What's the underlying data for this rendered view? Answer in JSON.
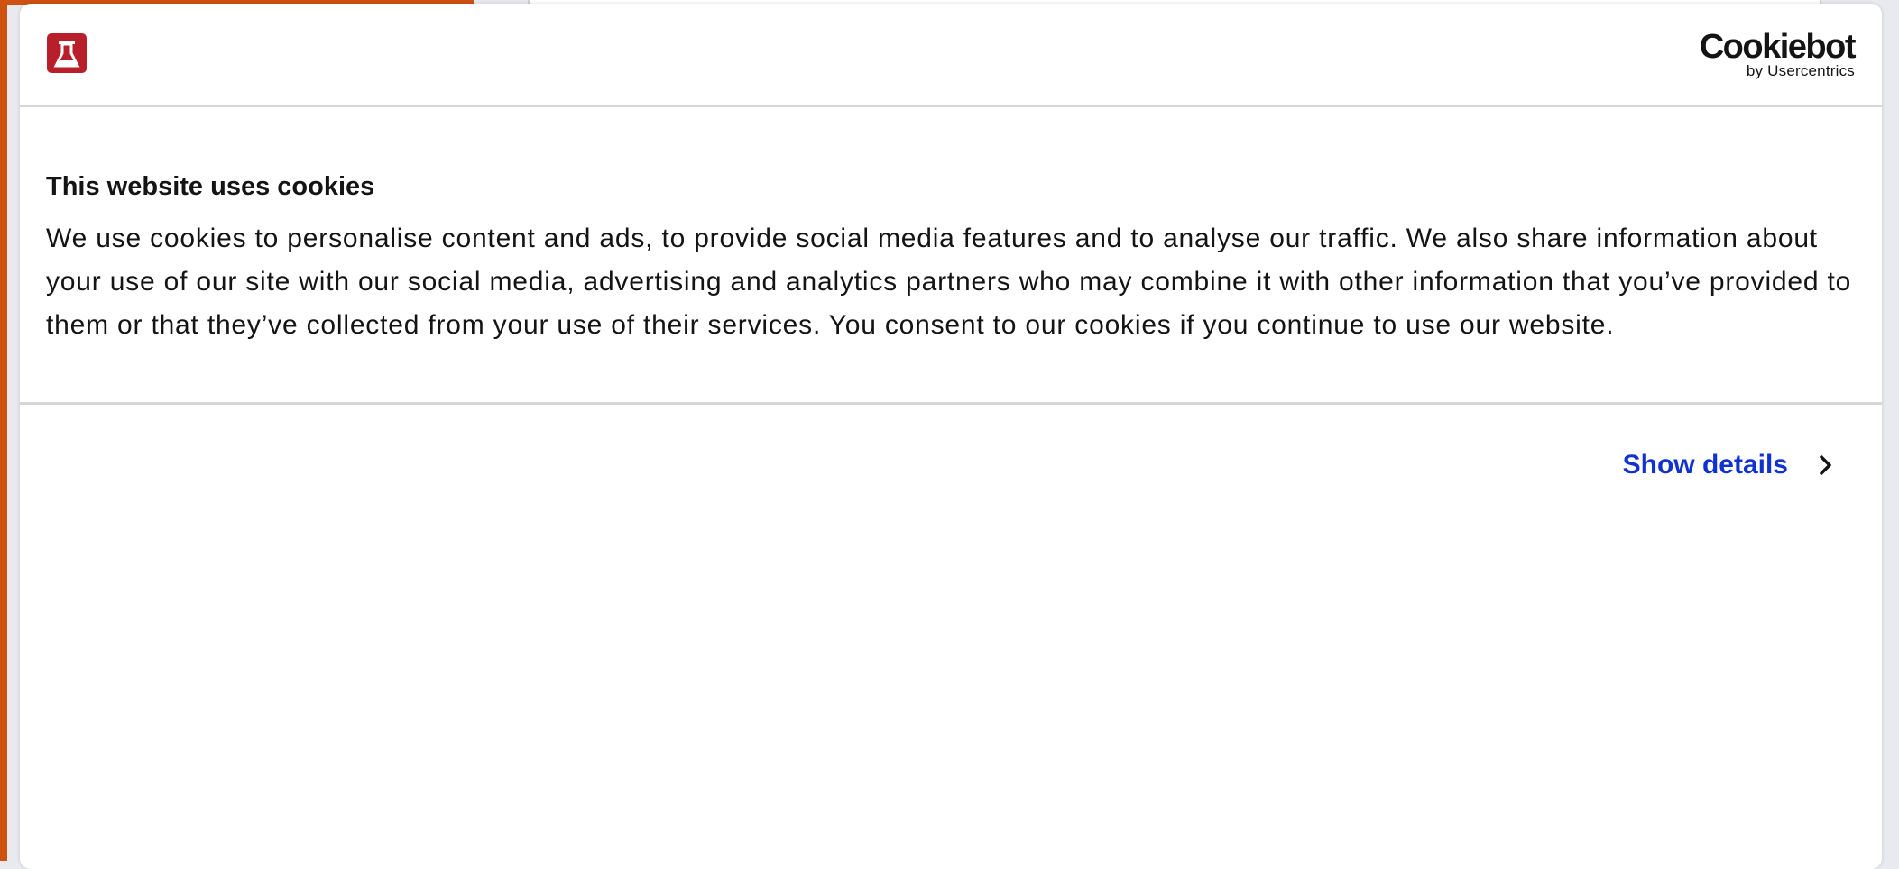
{
  "dialog": {
    "site_logo_icon": "flask-icon",
    "brand_colors": {
      "site_logo": "#b81f2a",
      "link": "#1032cf",
      "page_accent": "#cf5212"
    },
    "provider": {
      "name": "Cookiebot",
      "byline": "by Usercentrics"
    },
    "title": "This website uses cookies",
    "message": "We use cookies to personalise content and ads, to provide social media features and to analyse our traffic. We also share information about your use of our site with our social media, advertising and analytics partners who may combine it with other information that you’ve provided to them or that they’ve collected from your use of their services. You consent to our cookies if you continue to use our website.",
    "show_details_label": "Show details",
    "show_details_icon": "chevron-right-icon"
  }
}
